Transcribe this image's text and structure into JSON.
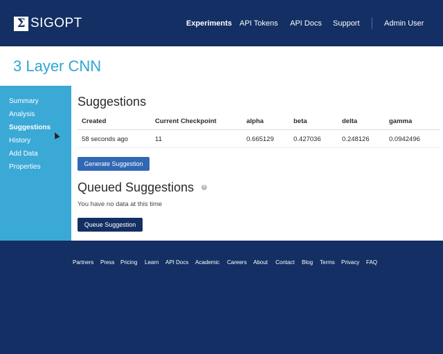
{
  "header": {
    "logo_text": "SIGOPT",
    "logo_mark": "Σ",
    "nav": [
      {
        "label": "Experiments",
        "active": true
      },
      {
        "label": "API Tokens",
        "active": false
      },
      {
        "label": "API Docs",
        "active": false
      },
      {
        "label": "Support",
        "active": false
      },
      {
        "label": "Admin User",
        "active": false
      }
    ]
  },
  "page": {
    "title": "3 Layer CNN"
  },
  "sidebar": {
    "items": [
      {
        "label": "Summary",
        "active": false
      },
      {
        "label": "Analysis",
        "active": false
      },
      {
        "label": "Suggestions",
        "active": true
      },
      {
        "label": "History",
        "active": false
      },
      {
        "label": "Add Data",
        "active": false
      },
      {
        "label": "Properties",
        "active": false
      }
    ]
  },
  "suggestions": {
    "title": "Suggestions",
    "columns": [
      "Created",
      "Current Checkpoint",
      "alpha",
      "beta",
      "delta",
      "gamma"
    ],
    "rows": [
      [
        "58 seconds ago",
        "11",
        "0.665129",
        "0.427036",
        "0.248126",
        "0.0942496"
      ]
    ],
    "generate_button": "Generate Suggestion"
  },
  "queued": {
    "title": "Queued Suggestions",
    "help_icon": "?",
    "empty_text": "You have no data at this time",
    "queue_button": "Queue Suggestion"
  },
  "footer": {
    "links": [
      "Partners",
      "Press",
      "Pricing",
      "Learn",
      "API Docs",
      "Academic",
      "Careers",
      "About",
      "Contact",
      "Blog",
      "Terms",
      "Privacy",
      "FAQ"
    ]
  },
  "colors": {
    "navy": "#132f63",
    "sidebar_blue": "#3aa9d6",
    "title_blue": "#2ea6d2",
    "button_blue": "#3168b3"
  }
}
